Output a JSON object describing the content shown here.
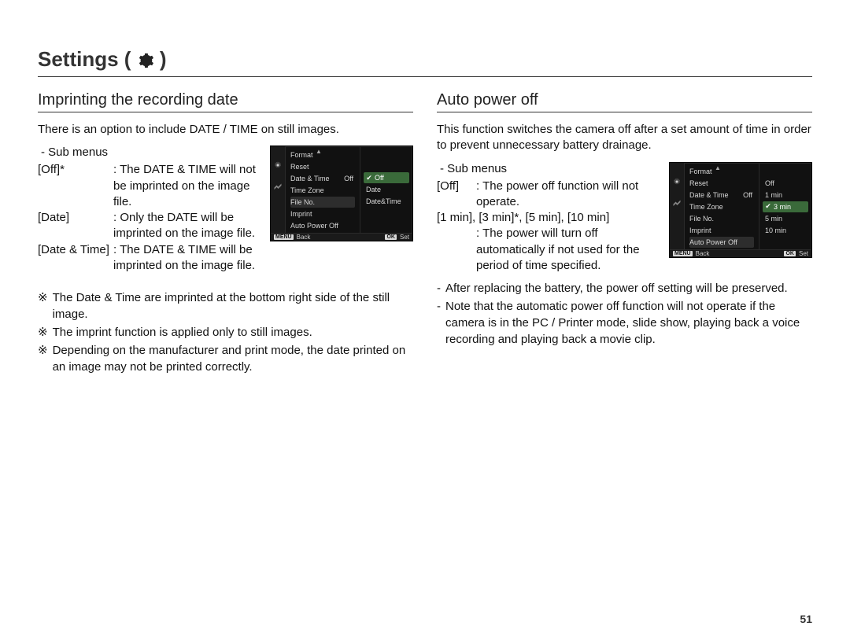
{
  "page_number": "51",
  "header": {
    "title_prefix": "Settings (",
    "title_suffix": ")",
    "icon_name": "gear-icon"
  },
  "left": {
    "section_title": "Imprinting the recording date",
    "intro": "There is an option to include DATE / TIME on still images.",
    "submenu_label": "- Sub menus",
    "items": [
      {
        "key": "[Off]*",
        "val": ": The DATE & TIME will not be imprinted on the image file."
      },
      {
        "key": "[Date]",
        "val": ": Only the DATE will be imprinted on the image file."
      },
      {
        "key": "[Date & Time]",
        "val": ": The DATE & TIME will be imprinted on the image file."
      }
    ],
    "notes": [
      "The Date & Time are imprinted at the bottom right side of the still image.",
      "The imprint function is applied only to still images.",
      "Depending on the manufacturer and print mode, the date printed on an image may not be printed correctly."
    ],
    "note_marker": "※",
    "cam": {
      "menu_items": [
        {
          "label": "Format",
          "value": ""
        },
        {
          "label": "Reset",
          "value": ""
        },
        {
          "label": "Date & Time",
          "value": "Off"
        },
        {
          "label": "Time Zone",
          "value": ""
        },
        {
          "label": "File No.",
          "value": "",
          "highlight": true
        },
        {
          "label": "Imprint",
          "value": ""
        },
        {
          "label": "Auto Power Off",
          "value": ""
        }
      ],
      "options": [
        {
          "label": "Off",
          "selected": true
        },
        {
          "label": "Date"
        },
        {
          "label": "Date&Time"
        }
      ],
      "footer": {
        "left_key": "MENU",
        "left_label": "Back",
        "right_key": "OK",
        "right_label": "Set"
      }
    }
  },
  "right": {
    "section_title": "Auto power off",
    "intro": "This function switches the camera off after a set amount of time in order to prevent unnecessary battery drainage.",
    "submenu_label": "- Sub menus",
    "items": [
      {
        "key": "[Off]",
        "val": ": The power off function will not operate."
      },
      {
        "key_line": "[1 min], [3 min]*, [5 min], [10 min]",
        "val": ": The power will turn off automatically if not used for the period of time specified."
      }
    ],
    "bullets": [
      "After replacing the battery, the power off setting will be preserved.",
      "Note that the automatic power off function will not operate if the camera is in the PC / Printer mode, slide show, playing back a voice recording and playing back a movie clip."
    ],
    "bullet_marker": "-",
    "cam": {
      "menu_items": [
        {
          "label": "Format",
          "value": ""
        },
        {
          "label": "Reset",
          "value": ""
        },
        {
          "label": "Date & Time",
          "value": "Off"
        },
        {
          "label": "Time Zone",
          "value": ""
        },
        {
          "label": "File No.",
          "value": ""
        },
        {
          "label": "Imprint",
          "value": ""
        },
        {
          "label": "Auto Power Off",
          "value": "",
          "highlight": true
        }
      ],
      "options": [
        {
          "label": "Off"
        },
        {
          "label": "1 min"
        },
        {
          "label": "3 min",
          "selected": true
        },
        {
          "label": "5 min"
        },
        {
          "label": "10 min"
        }
      ],
      "footer": {
        "left_key": "MENU",
        "left_label": "Back",
        "right_key": "OK",
        "right_label": "Set"
      }
    }
  }
}
